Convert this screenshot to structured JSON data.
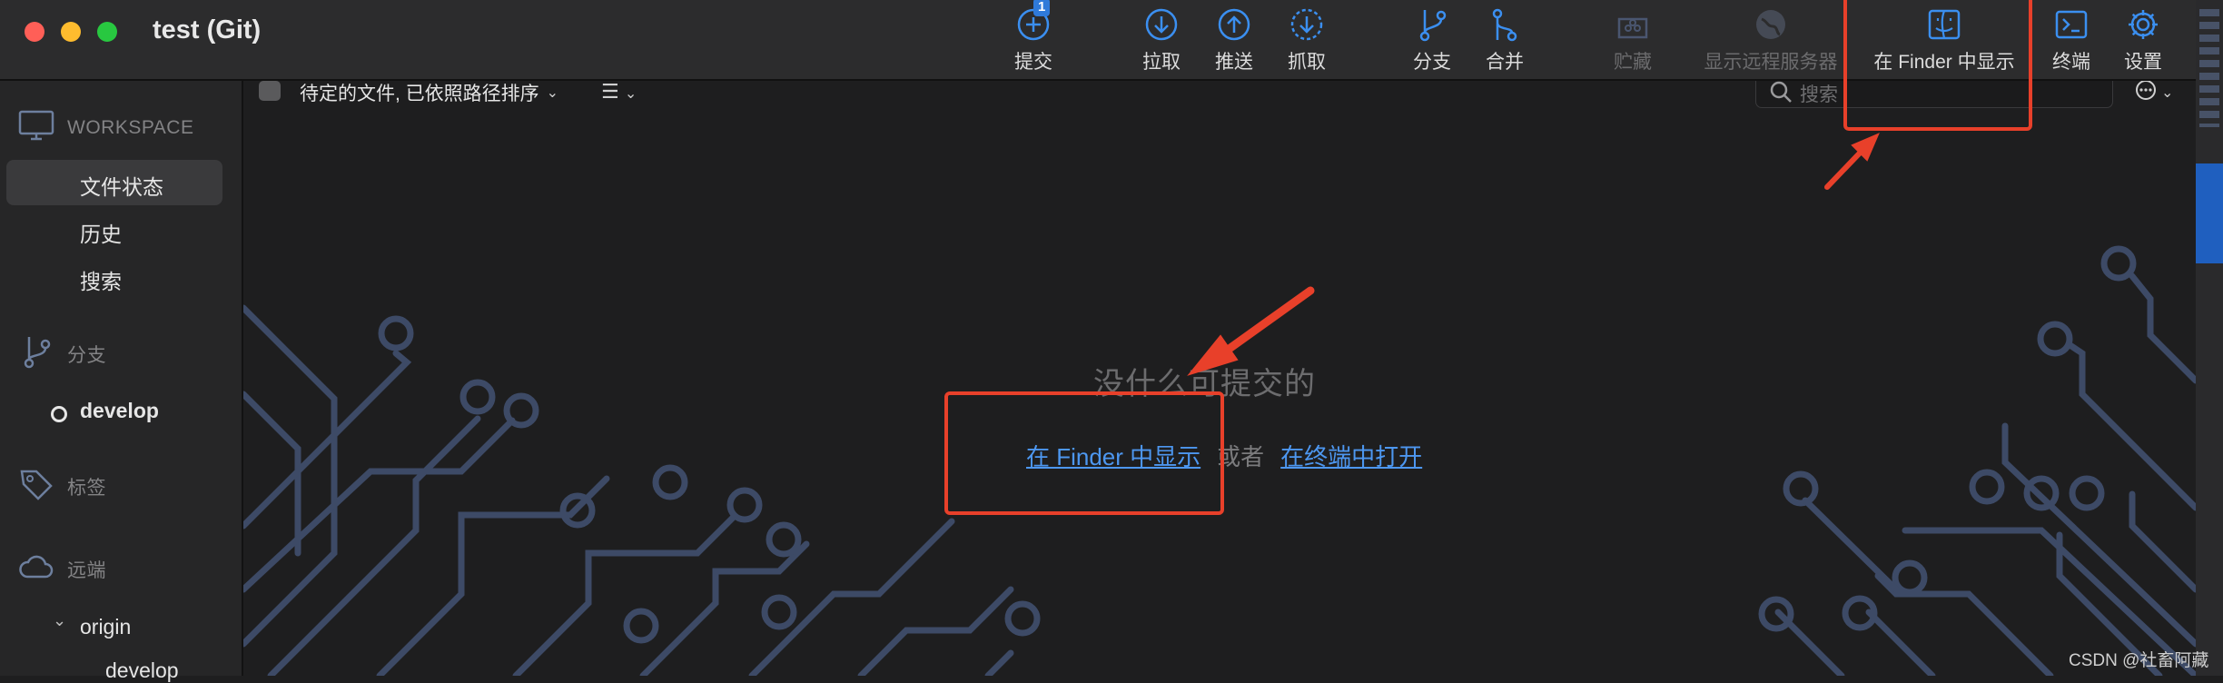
{
  "window": {
    "title": "test (Git)"
  },
  "toolbar": [
    {
      "id": "commit",
      "label": "提交",
      "badge": "1",
      "icon": "plus-circle-icon",
      "enabled": true
    },
    {
      "id": "pull",
      "label": "拉取",
      "icon": "arrow-down-circle-icon",
      "enabled": true
    },
    {
      "id": "push",
      "label": "推送",
      "icon": "arrow-up-circle-icon",
      "enabled": true
    },
    {
      "id": "fetch",
      "label": "抓取",
      "icon": "dashed-arrow-down-circle-icon",
      "enabled": true
    },
    {
      "id": "branch",
      "label": "分支",
      "icon": "branch-icon",
      "enabled": true
    },
    {
      "id": "merge",
      "label": "合并",
      "icon": "merge-icon",
      "enabled": true
    },
    {
      "id": "stash",
      "label": "贮藏",
      "icon": "stash-icon",
      "enabled": false
    },
    {
      "id": "remote",
      "label": "显示远程服务器",
      "icon": "globe-icon",
      "enabled": false
    },
    {
      "id": "finder",
      "label": "在 Finder 中显示",
      "icon": "finder-icon",
      "enabled": true
    },
    {
      "id": "terminal",
      "label": "终端",
      "icon": "terminal-icon",
      "enabled": true
    },
    {
      "id": "settings",
      "label": "设置",
      "icon": "gear-icon",
      "enabled": true
    }
  ],
  "sidebar": {
    "workspace": {
      "title": "WORKSPACE",
      "icon": "monitor-icon",
      "items": [
        "文件状态",
        "历史",
        "搜索"
      ],
      "selected": "文件状态"
    },
    "branches": {
      "title": "分支",
      "icon": "branch-icon",
      "items": [
        "develop"
      ]
    },
    "tags": {
      "title": "标签",
      "icon": "tag-icon"
    },
    "remotes": {
      "title": "远端",
      "icon": "cloud-icon",
      "origin": "origin",
      "items": [
        "develop"
      ]
    }
  },
  "filterbar": {
    "pending_label": "待定的文件, 已依照路径排序",
    "search_placeholder": "搜索"
  },
  "empty_state": {
    "message": "没什么可提交的",
    "show_in_finder": "在 Finder 中显示",
    "or": "或者",
    "open_in_terminal": "在终端中打开"
  },
  "watermark": "CSDN @社畜阿藏",
  "colors": {
    "accent": "#4d97f0",
    "annotation": "#e8402a",
    "circuit": "#3d4a66"
  }
}
